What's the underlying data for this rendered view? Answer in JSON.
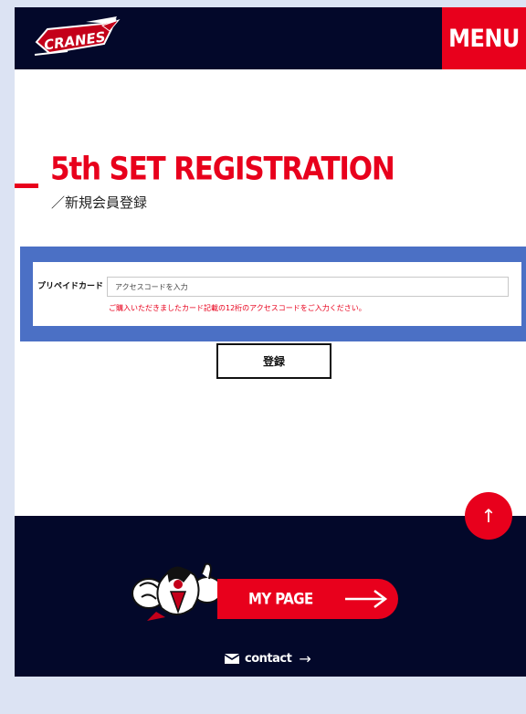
{
  "header": {
    "logo_text": "CRANES",
    "menu_label": "MENU"
  },
  "page": {
    "title": "5th SET REGISTRATION",
    "subtitle": "／新規会員登録"
  },
  "form": {
    "field_label": "プリペイドカード",
    "input_placeholder": "アクセスコードを入力",
    "input_value": "",
    "note": "ご購入いただきましたカード記載の12桁のアクセスコードをご入力ください。",
    "submit_label": "登録"
  },
  "footer": {
    "scroll_top_icon": "↑",
    "mypage_label": "MY PAGE",
    "contact_label": "contact",
    "contact_arrow": "→"
  },
  "colors": {
    "accent": "#e8001c",
    "navy": "#03082a",
    "form_band": "#4b70c5",
    "page_bg": "#dce3f3"
  }
}
